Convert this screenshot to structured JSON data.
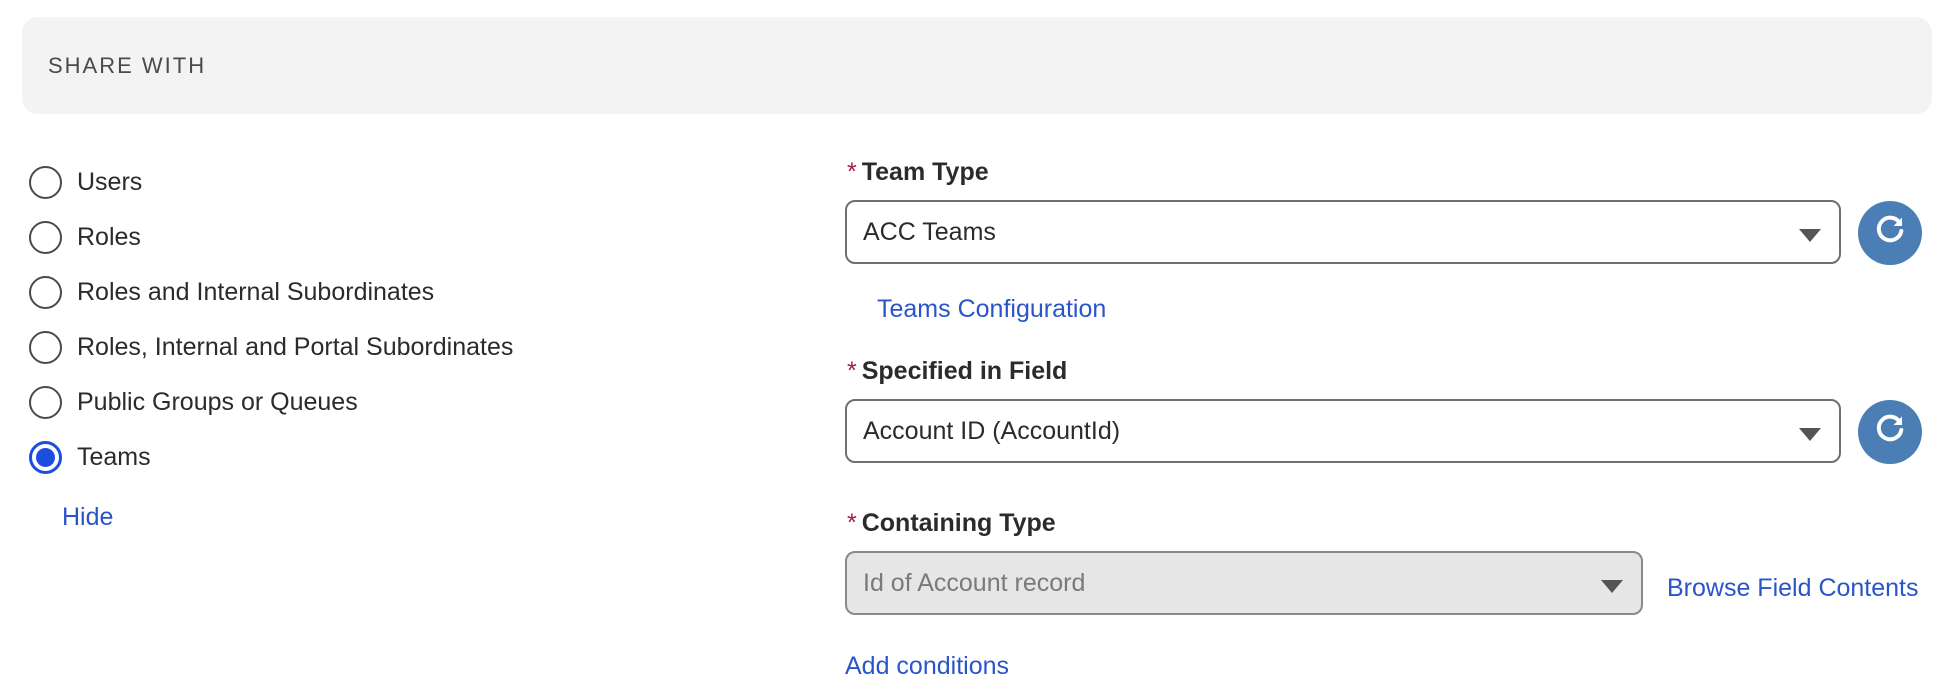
{
  "header": {
    "title": "SHARE WITH"
  },
  "share_options": [
    {
      "label": "Users",
      "checked": false
    },
    {
      "label": "Roles",
      "checked": false
    },
    {
      "label": "Roles and Internal Subordinates",
      "checked": false
    },
    {
      "label": "Roles, Internal and Portal Subordinates",
      "checked": false
    },
    {
      "label": "Public Groups or Queues",
      "checked": false
    },
    {
      "label": "Teams",
      "checked": true
    }
  ],
  "hide_link": "Hide",
  "team_type": {
    "required_mark": "*",
    "label": "Team Type",
    "value": "ACC Teams",
    "config_link": "Teams Configuration"
  },
  "specified_field": {
    "required_mark": "*",
    "label": "Specified in Field",
    "value": "Account ID (AccountId)"
  },
  "containing_type": {
    "required_mark": "*",
    "label": "Containing Type",
    "value": "Id of Account record",
    "browse_link": "Browse Field Contents"
  },
  "add_conditions_link": "Add conditions",
  "icons": {
    "refresh": "refresh-icon",
    "dropdown": "chevron-down-icon"
  },
  "colors": {
    "accent": "#1b4ee0",
    "link": "#2a55c9",
    "refresh_button": "#4b7eb5",
    "required": "#a8184b"
  }
}
